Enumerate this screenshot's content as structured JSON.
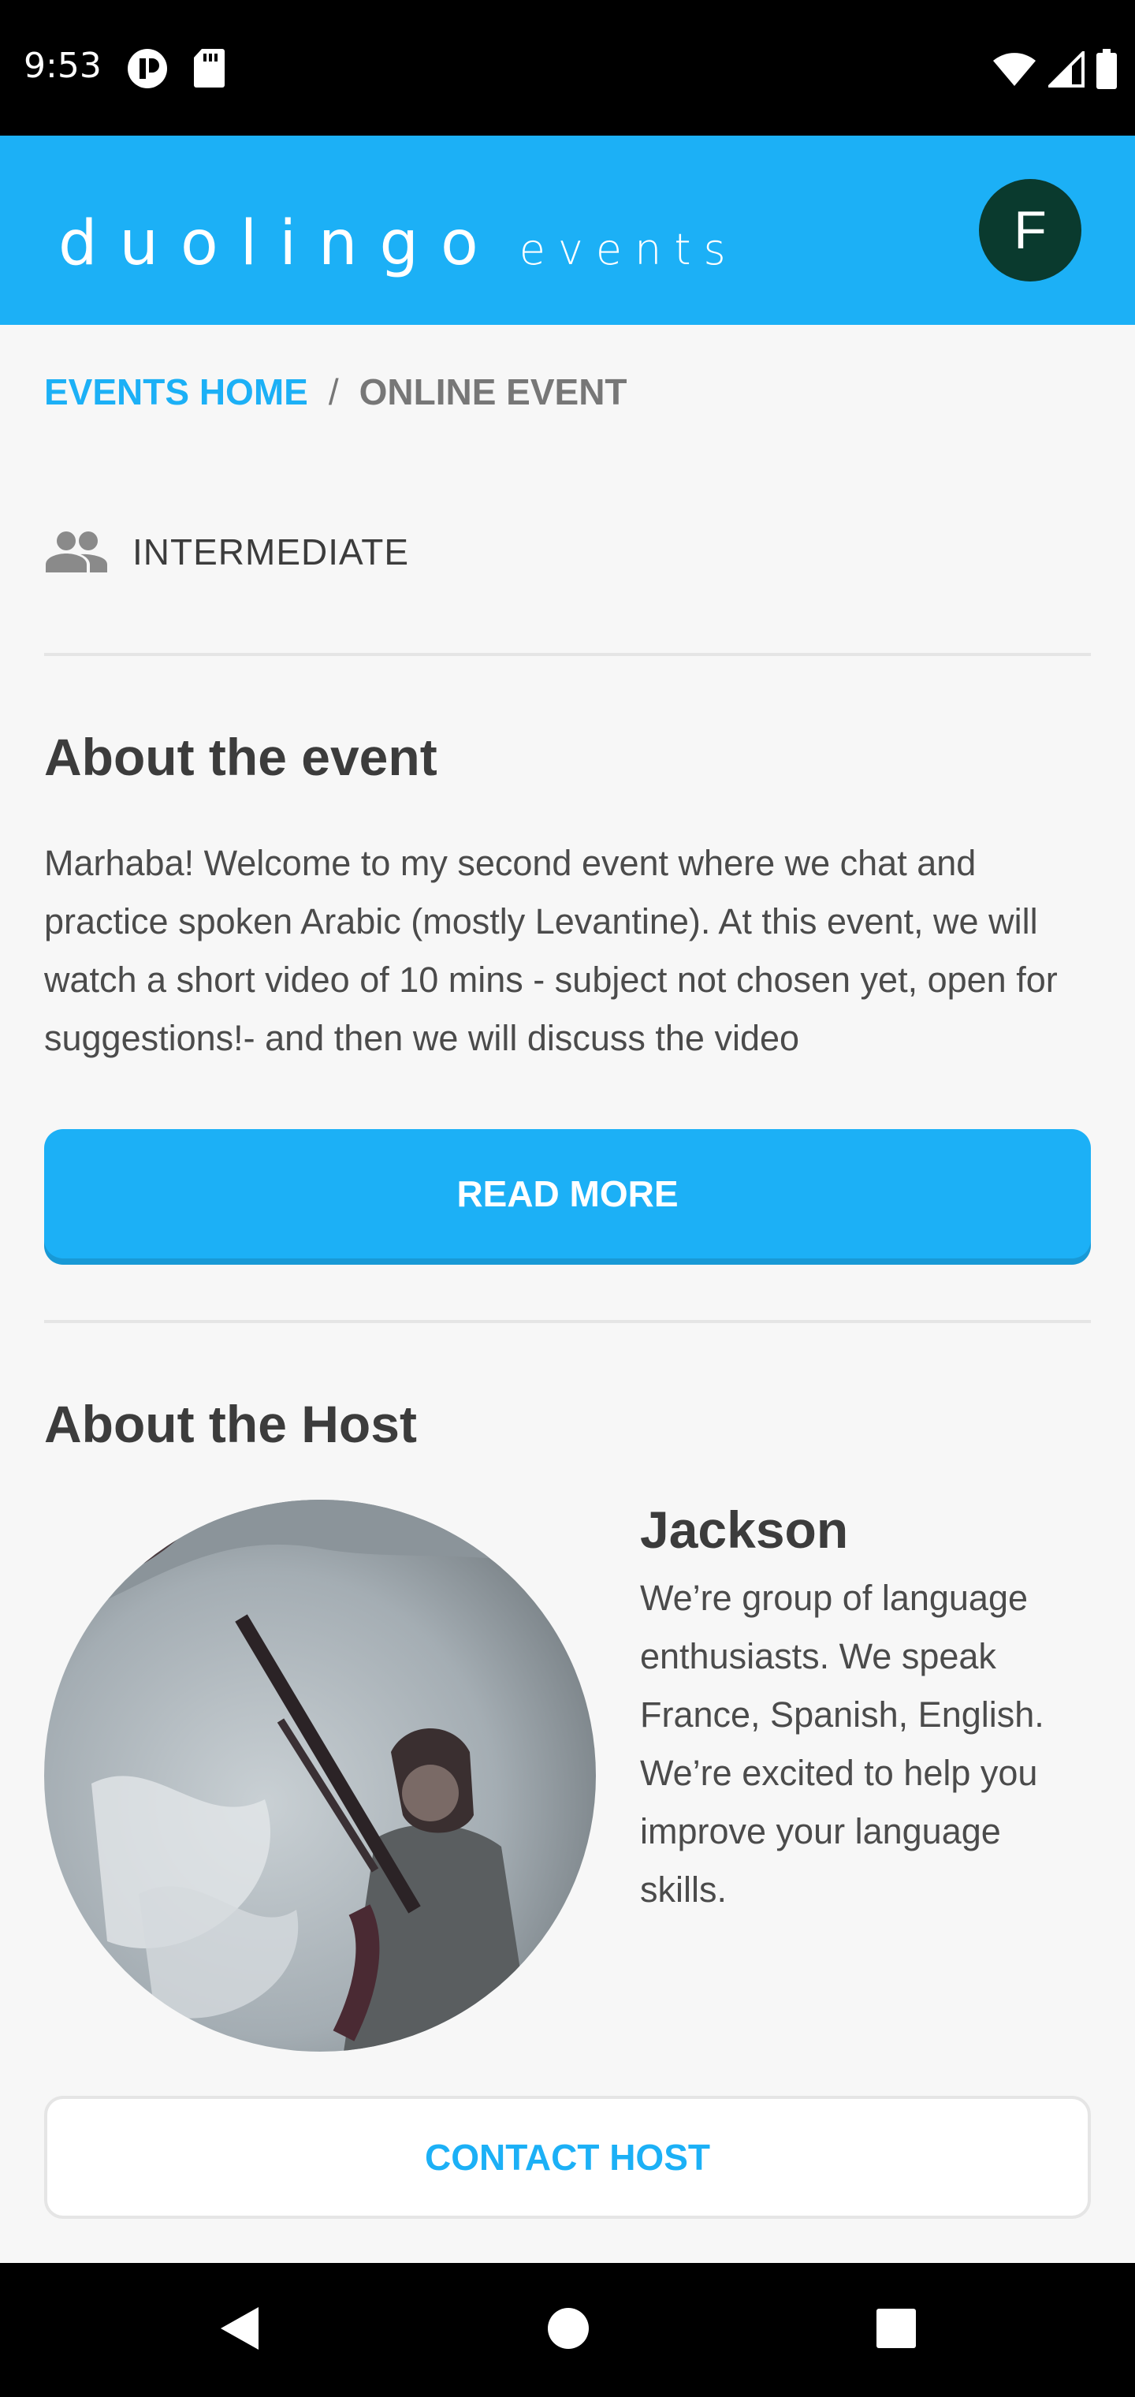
{
  "status_bar": {
    "time": "9:53",
    "icons": [
      "notification-icon",
      "sd-card-icon",
      "wifi-icon",
      "cell-signal-icon",
      "battery-icon"
    ]
  },
  "header": {
    "logo_main": "duolingo",
    "logo_sub": "events",
    "avatar_initial": "F",
    "brand_color": "#1cb0f6",
    "avatar_color": "#0a3a2e"
  },
  "breadcrumb": {
    "home": "EVENTS HOME",
    "separator": "/",
    "current": "ONLINE EVENT"
  },
  "event": {
    "level_icon": "people-icon",
    "level": "INTERMEDIATE",
    "about_title": "About the event",
    "about_text": "Marhaba! Welcome to my second event where we chat and practice spoken Arabic (mostly Levantine). At this event, we will watch a short video of 10 mins - subject not chosen yet, open for suggestions!- and then we will discuss the video",
    "read_more": "READ MORE"
  },
  "host": {
    "section_title": "About the Host",
    "name": "Jackson",
    "bio": "We’re group of language enthusiasts. We speak France, Spanish, English. We’re excited to help you improve your language skills.",
    "contact": "CONTACT HOST"
  },
  "nav_bar": {
    "buttons": [
      "back-icon",
      "home-icon",
      "recents-icon"
    ]
  }
}
